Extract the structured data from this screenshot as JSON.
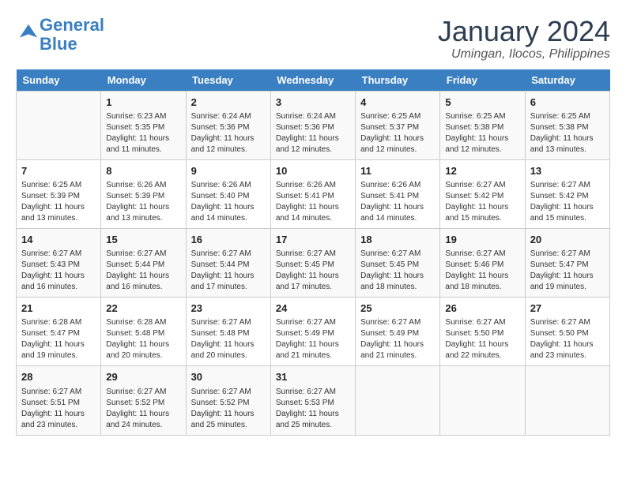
{
  "logo": {
    "line1": "General",
    "line2": "Blue"
  },
  "title": "January 2024",
  "location": "Umingan, Ilocos, Philippines",
  "days_of_week": [
    "Sunday",
    "Monday",
    "Tuesday",
    "Wednesday",
    "Thursday",
    "Friday",
    "Saturday"
  ],
  "weeks": [
    [
      {
        "num": "",
        "sunrise": "",
        "sunset": "",
        "daylight": ""
      },
      {
        "num": "1",
        "sunrise": "Sunrise: 6:23 AM",
        "sunset": "Sunset: 5:35 PM",
        "daylight": "Daylight: 11 hours and 11 minutes."
      },
      {
        "num": "2",
        "sunrise": "Sunrise: 6:24 AM",
        "sunset": "Sunset: 5:36 PM",
        "daylight": "Daylight: 11 hours and 12 minutes."
      },
      {
        "num": "3",
        "sunrise": "Sunrise: 6:24 AM",
        "sunset": "Sunset: 5:36 PM",
        "daylight": "Daylight: 11 hours and 12 minutes."
      },
      {
        "num": "4",
        "sunrise": "Sunrise: 6:25 AM",
        "sunset": "Sunset: 5:37 PM",
        "daylight": "Daylight: 11 hours and 12 minutes."
      },
      {
        "num": "5",
        "sunrise": "Sunrise: 6:25 AM",
        "sunset": "Sunset: 5:38 PM",
        "daylight": "Daylight: 11 hours and 12 minutes."
      },
      {
        "num": "6",
        "sunrise": "Sunrise: 6:25 AM",
        "sunset": "Sunset: 5:38 PM",
        "daylight": "Daylight: 11 hours and 13 minutes."
      }
    ],
    [
      {
        "num": "7",
        "sunrise": "Sunrise: 6:25 AM",
        "sunset": "Sunset: 5:39 PM",
        "daylight": "Daylight: 11 hours and 13 minutes."
      },
      {
        "num": "8",
        "sunrise": "Sunrise: 6:26 AM",
        "sunset": "Sunset: 5:39 PM",
        "daylight": "Daylight: 11 hours and 13 minutes."
      },
      {
        "num": "9",
        "sunrise": "Sunrise: 6:26 AM",
        "sunset": "Sunset: 5:40 PM",
        "daylight": "Daylight: 11 hours and 14 minutes."
      },
      {
        "num": "10",
        "sunrise": "Sunrise: 6:26 AM",
        "sunset": "Sunset: 5:41 PM",
        "daylight": "Daylight: 11 hours and 14 minutes."
      },
      {
        "num": "11",
        "sunrise": "Sunrise: 6:26 AM",
        "sunset": "Sunset: 5:41 PM",
        "daylight": "Daylight: 11 hours and 14 minutes."
      },
      {
        "num": "12",
        "sunrise": "Sunrise: 6:27 AM",
        "sunset": "Sunset: 5:42 PM",
        "daylight": "Daylight: 11 hours and 15 minutes."
      },
      {
        "num": "13",
        "sunrise": "Sunrise: 6:27 AM",
        "sunset": "Sunset: 5:42 PM",
        "daylight": "Daylight: 11 hours and 15 minutes."
      }
    ],
    [
      {
        "num": "14",
        "sunrise": "Sunrise: 6:27 AM",
        "sunset": "Sunset: 5:43 PM",
        "daylight": "Daylight: 11 hours and 16 minutes."
      },
      {
        "num": "15",
        "sunrise": "Sunrise: 6:27 AM",
        "sunset": "Sunset: 5:44 PM",
        "daylight": "Daylight: 11 hours and 16 minutes."
      },
      {
        "num": "16",
        "sunrise": "Sunrise: 6:27 AM",
        "sunset": "Sunset: 5:44 PM",
        "daylight": "Daylight: 11 hours and 17 minutes."
      },
      {
        "num": "17",
        "sunrise": "Sunrise: 6:27 AM",
        "sunset": "Sunset: 5:45 PM",
        "daylight": "Daylight: 11 hours and 17 minutes."
      },
      {
        "num": "18",
        "sunrise": "Sunrise: 6:27 AM",
        "sunset": "Sunset: 5:45 PM",
        "daylight": "Daylight: 11 hours and 18 minutes."
      },
      {
        "num": "19",
        "sunrise": "Sunrise: 6:27 AM",
        "sunset": "Sunset: 5:46 PM",
        "daylight": "Daylight: 11 hours and 18 minutes."
      },
      {
        "num": "20",
        "sunrise": "Sunrise: 6:27 AM",
        "sunset": "Sunset: 5:47 PM",
        "daylight": "Daylight: 11 hours and 19 minutes."
      }
    ],
    [
      {
        "num": "21",
        "sunrise": "Sunrise: 6:28 AM",
        "sunset": "Sunset: 5:47 PM",
        "daylight": "Daylight: 11 hours and 19 minutes."
      },
      {
        "num": "22",
        "sunrise": "Sunrise: 6:28 AM",
        "sunset": "Sunset: 5:48 PM",
        "daylight": "Daylight: 11 hours and 20 minutes."
      },
      {
        "num": "23",
        "sunrise": "Sunrise: 6:27 AM",
        "sunset": "Sunset: 5:48 PM",
        "daylight": "Daylight: 11 hours and 20 minutes."
      },
      {
        "num": "24",
        "sunrise": "Sunrise: 6:27 AM",
        "sunset": "Sunset: 5:49 PM",
        "daylight": "Daylight: 11 hours and 21 minutes."
      },
      {
        "num": "25",
        "sunrise": "Sunrise: 6:27 AM",
        "sunset": "Sunset: 5:49 PM",
        "daylight": "Daylight: 11 hours and 21 minutes."
      },
      {
        "num": "26",
        "sunrise": "Sunrise: 6:27 AM",
        "sunset": "Sunset: 5:50 PM",
        "daylight": "Daylight: 11 hours and 22 minutes."
      },
      {
        "num": "27",
        "sunrise": "Sunrise: 6:27 AM",
        "sunset": "Sunset: 5:50 PM",
        "daylight": "Daylight: 11 hours and 23 minutes."
      }
    ],
    [
      {
        "num": "28",
        "sunrise": "Sunrise: 6:27 AM",
        "sunset": "Sunset: 5:51 PM",
        "daylight": "Daylight: 11 hours and 23 minutes."
      },
      {
        "num": "29",
        "sunrise": "Sunrise: 6:27 AM",
        "sunset": "Sunset: 5:52 PM",
        "daylight": "Daylight: 11 hours and 24 minutes."
      },
      {
        "num": "30",
        "sunrise": "Sunrise: 6:27 AM",
        "sunset": "Sunset: 5:52 PM",
        "daylight": "Daylight: 11 hours and 25 minutes."
      },
      {
        "num": "31",
        "sunrise": "Sunrise: 6:27 AM",
        "sunset": "Sunset: 5:53 PM",
        "daylight": "Daylight: 11 hours and 25 minutes."
      },
      {
        "num": "",
        "sunrise": "",
        "sunset": "",
        "daylight": ""
      },
      {
        "num": "",
        "sunrise": "",
        "sunset": "",
        "daylight": ""
      },
      {
        "num": "",
        "sunrise": "",
        "sunset": "",
        "daylight": ""
      }
    ]
  ]
}
